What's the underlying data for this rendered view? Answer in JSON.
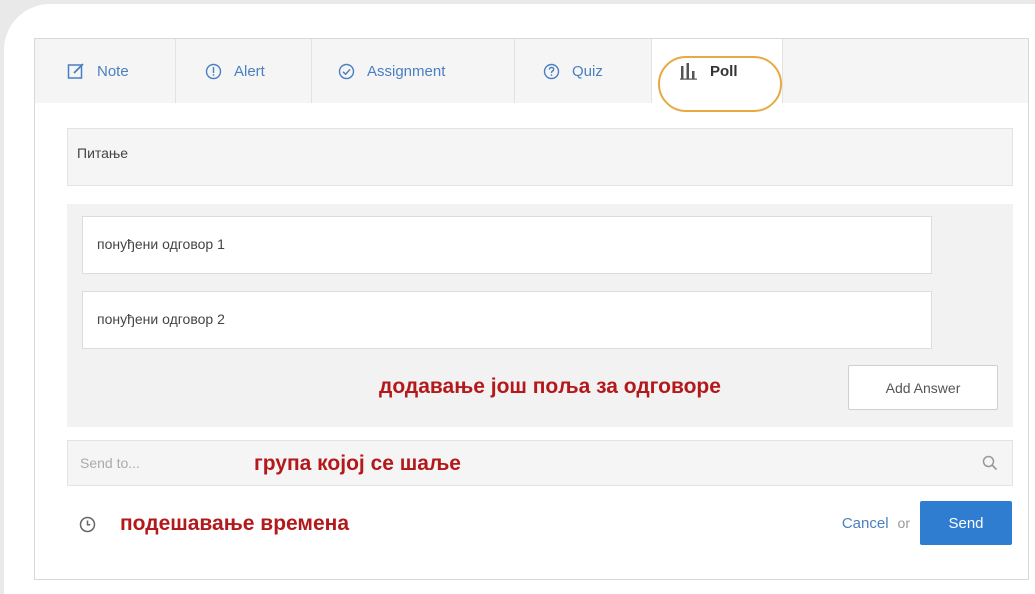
{
  "tabs": [
    {
      "label": "Note",
      "icon": "edit-icon"
    },
    {
      "label": "Alert",
      "icon": "alert-icon"
    },
    {
      "label": "Assignment",
      "icon": "check-circle-icon"
    },
    {
      "label": "Quiz",
      "icon": "question-icon"
    },
    {
      "label": "Poll",
      "icon": "bar-chart-icon",
      "active": true
    }
  ],
  "poll": {
    "question": "Питање",
    "answers": [
      "понуђени одговор 1",
      "понуђени одговор 2"
    ],
    "add_answer_label": "Add Answer"
  },
  "send_to": {
    "placeholder": "Send to..."
  },
  "footer": {
    "cancel_label": "Cancel",
    "or_text": "or",
    "send_label": "Send"
  },
  "annotations": {
    "add_fields": "додавање још поља за одговоре",
    "group": "група којој се шаље",
    "time": "подешавање времена"
  },
  "colors": {
    "accent": "#2f7dd1",
    "link": "#4a7fc0",
    "annotation": "#b3191b",
    "highlight": "#e8a940"
  }
}
